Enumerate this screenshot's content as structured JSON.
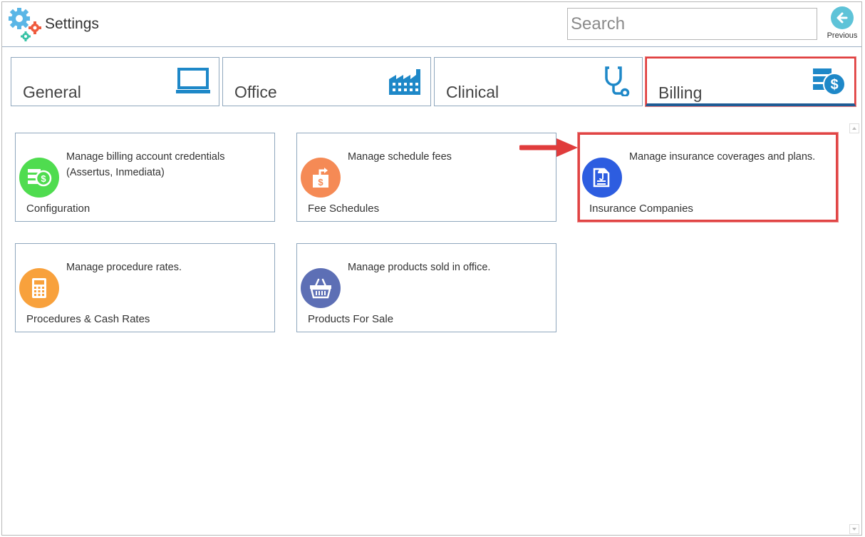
{
  "app": {
    "title": "Settings",
    "logo_icon": "gears-icon"
  },
  "search": {
    "placeholder": "Search",
    "value": ""
  },
  "previous": {
    "label": "Previous",
    "icon": "arrow-left-icon"
  },
  "tabs": [
    {
      "label": "General",
      "icon": "monitor-icon",
      "selected": false
    },
    {
      "label": "Office",
      "icon": "factory-icon",
      "selected": false
    },
    {
      "label": "Clinical",
      "icon": "stethoscope-icon",
      "selected": false
    },
    {
      "label": "Billing",
      "icon": "money-stack-icon",
      "selected": true
    }
  ],
  "cards": [
    {
      "title": "Configuration",
      "description": "Manage billing account credentials (Assertus, Inmediata)",
      "icon": "money-icon",
      "color": "#4fdc4f"
    },
    {
      "title": "Fee Schedules",
      "description": "Manage schedule fees",
      "icon": "fee-bag-icon",
      "color": "#f58a55"
    },
    {
      "title": "Insurance Companies",
      "description": "Manage insurance coverages and plans.",
      "icon": "insurance-document-icon",
      "color": "#2d5de0",
      "highlighted": true
    },
    {
      "title": "Procedures & Cash Rates",
      "description": "Manage procedure rates.",
      "icon": "calculator-icon",
      "color": "#f8a13c"
    },
    {
      "title": "Products For Sale",
      "description": "Manage products sold in office.",
      "icon": "basket-icon",
      "color": "#5d6fb5"
    }
  ],
  "colors": {
    "accent": "#2a86c8",
    "highlight": "#e03c3c",
    "border": "#8fa7bd"
  }
}
